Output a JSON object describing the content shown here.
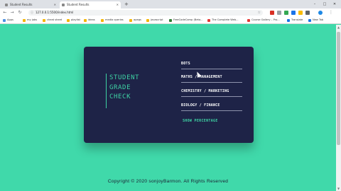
{
  "browser": {
    "tabs": [
      {
        "label": "Student Results"
      },
      {
        "label": "Student Results"
      }
    ],
    "new_tab": "+",
    "window_controls": {
      "minimize": "–",
      "maximize": "□",
      "close": "✕"
    },
    "url": "127.0.0.1:5500/index.html",
    "bookmarks": [
      {
        "label": "Apps",
        "color": "#4a90e2"
      },
      {
        "label": "my jobs",
        "color": "#f4b400"
      },
      {
        "label": "cheat sheet",
        "color": "#f4b400"
      },
      {
        "label": "playlist",
        "color": "#f4b400"
      },
      {
        "label": "ideas",
        "color": "#f4b400"
      },
      {
        "label": "media queries",
        "color": "#f4b400"
      },
      {
        "label": "apegs",
        "color": "#f4b400"
      },
      {
        "label": "javascript",
        "color": "#f4b400"
      },
      {
        "label": "FreeCodeCamp (Beta...",
        "color": "#2e7d32"
      },
      {
        "label": "The Complete Web...",
        "color": "#e53935"
      },
      {
        "label": "Course Gallery – Pro...",
        "color": "#e53935"
      },
      {
        "label": "Translate",
        "color": "#1a73e8"
      },
      {
        "label": "New Tab",
        "color": "#1a73e8"
      }
    ]
  },
  "app": {
    "title_lines": [
      "STUDENT",
      "GRADE",
      "CHECK"
    ],
    "menu": {
      "bots": "BOTS",
      "maths": "MATHS / MANAGEMENT",
      "chemistry": "CHEMISTRY / MARKETING",
      "biology": "BIOLOGY / FINANCE"
    },
    "show_percentage": "SHOW PERCENTAGE"
  },
  "footer": "Copyright © 2020 sonjoyBarmon. All Rights Reserved",
  "colors": {
    "page_bg": "#40d9aa",
    "card_bg": "#1e2347",
    "accent": "#3ed3a4"
  }
}
